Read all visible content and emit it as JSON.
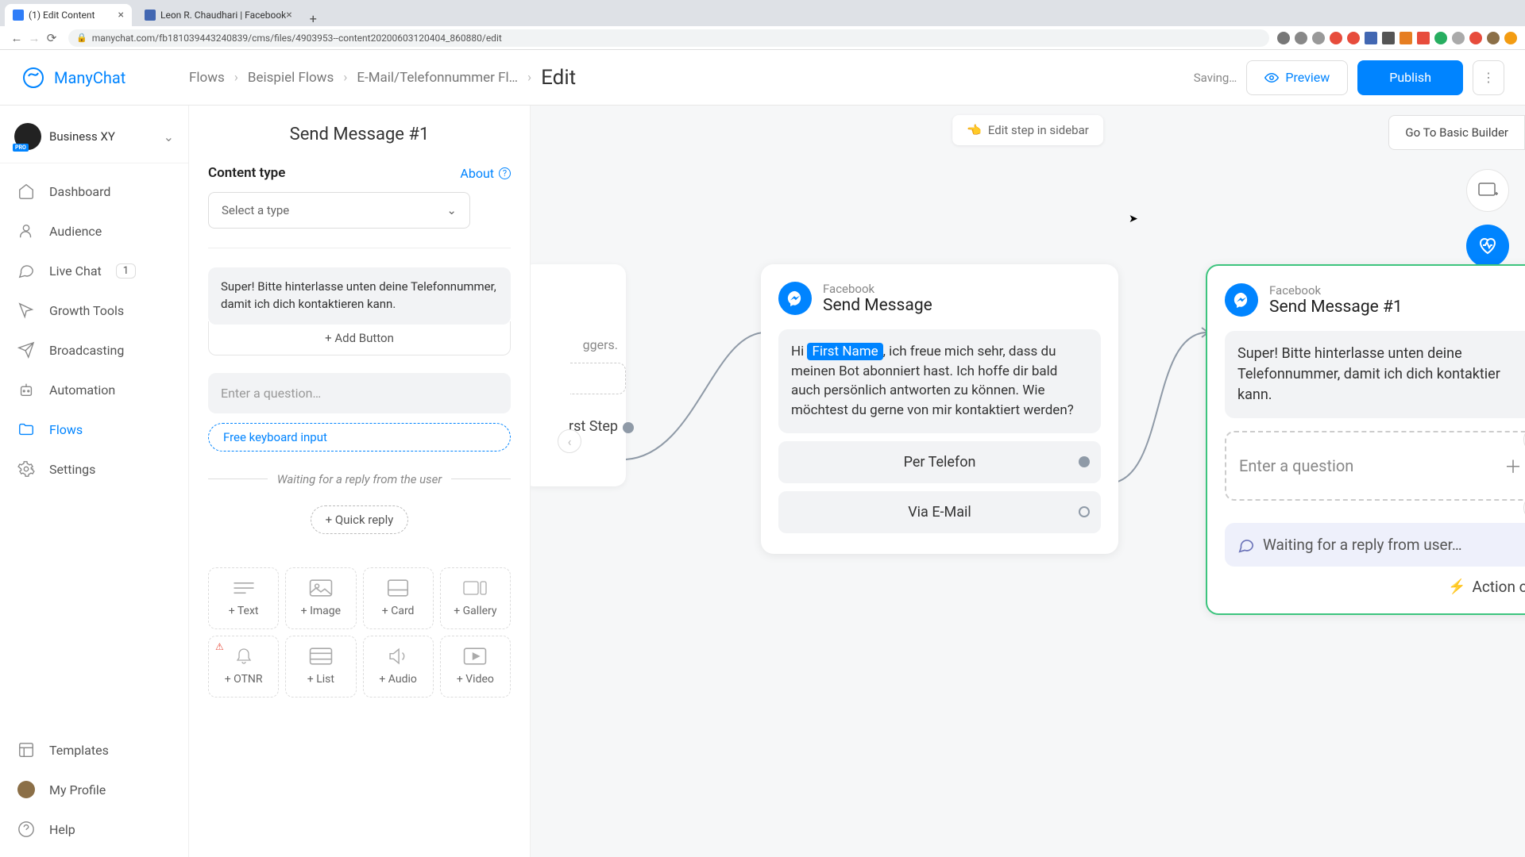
{
  "browser": {
    "tabs": [
      {
        "title": "(1) Edit Content",
        "active": true
      },
      {
        "title": "Leon R. Chaudhari | Facebook",
        "active": false
      }
    ],
    "url": "manychat.com/fb181039443240839/cms/files/4903953--content20200603120404_860880/edit"
  },
  "logo_text": "ManyChat",
  "breadcrumbs": {
    "items": [
      "Flows",
      "Beispiel Flows",
      "E-Mail/Telefonnummer Fl…"
    ],
    "current": "Edit"
  },
  "topbar": {
    "saving": "Saving…",
    "preview": "Preview",
    "publish": "Publish"
  },
  "canvas_hint": "Edit step in sidebar",
  "go_basic": "Go To Basic Builder",
  "business": {
    "name": "Business XY",
    "badge": "PRO"
  },
  "nav": {
    "dashboard": "Dashboard",
    "audience": "Audience",
    "livechat": "Live Chat",
    "livechat_badge": "1",
    "growth": "Growth Tools",
    "broadcasting": "Broadcasting",
    "automation": "Automation",
    "flows": "Flows",
    "settings": "Settings",
    "templates": "Templates",
    "profile": "My Profile",
    "help": "Help"
  },
  "panel": {
    "title": "Send Message #1",
    "content_type_label": "Content type",
    "about": "About",
    "select_placeholder": "Select a type",
    "message_text": "Super! Bitte hinterlasse unten deine Telefonnummer, damit ich dich kontaktieren kann.",
    "add_button": "+ Add Button",
    "question_placeholder": "Enter a question…",
    "free_keyboard": "Free keyboard input",
    "waiting": "Waiting for a reply from the user",
    "quick_reply": "+ Quick reply",
    "blocks": {
      "text": "+ Text",
      "image": "+ Image",
      "card": "+ Card",
      "gallery": "+ Gallery",
      "otnr": "+ OTNR",
      "list": "+ List",
      "audio": "+ Audio",
      "video": "+ Video"
    }
  },
  "node_peek": {
    "triggers": "ggers.",
    "step_label": "rst Step"
  },
  "node1": {
    "platform": "Facebook",
    "title": "Send Message",
    "msg_pre": "Hi ",
    "msg_var": "First Name",
    "msg_post": ", ich freue mich sehr, dass du meinen Bot abonniert hast. Ich hoffe dir bald auch persönlich antworten zu können. Wie möchtest du gerne von mir kontaktiert werden?",
    "btn1": "Per Telefon",
    "btn2": "Via E-Mail"
  },
  "node2": {
    "platform": "Facebook",
    "title": "Send Message #1",
    "msg": "Super! Bitte hinterlasse unten deine Telefonnummer, damit ich dich kontaktier kann.",
    "enter_q": "Enter a question",
    "waiting": "Waiting for a reply from user…",
    "action": "Action on"
  }
}
